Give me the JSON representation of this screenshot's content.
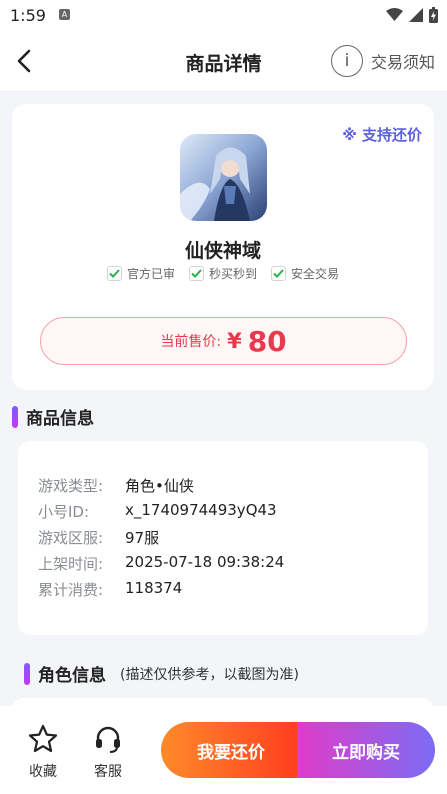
{
  "status": {
    "time": "1:59",
    "app_badge": "A"
  },
  "nav": {
    "title": "商品详情",
    "notice_label": "交易须知"
  },
  "product": {
    "bargain_tag": "※ 支持还价",
    "game_title": "仙侠神域",
    "badges": [
      {
        "label": "官方已审"
      },
      {
        "label": "秒买秒到"
      },
      {
        "label": "安全交易"
      }
    ],
    "price_label": "当前售价:",
    "price_symbol": "¥",
    "price_value": "80"
  },
  "product_info": {
    "title": "商品信息",
    "rows": [
      {
        "key": "游戏类型:",
        "value": "角色•仙侠"
      },
      {
        "key": "小号ID:",
        "value": "x_1740974493yQ43"
      },
      {
        "key": "游戏区服:",
        "value": "97服"
      },
      {
        "key": "上架时间:",
        "value": "2025-07-18 09:38:24"
      },
      {
        "key": "累计消费:",
        "value": "118374"
      }
    ]
  },
  "role_info": {
    "title": "角色信息",
    "note": "(描述仅供参考，以截图为准)"
  },
  "bottom": {
    "favorite_label": "收藏",
    "service_label": "客服",
    "bargain_button": "我要还价",
    "buy_button": "立即购买"
  },
  "colors": {
    "accent": "#5b5fe0",
    "price": "#e8394f",
    "check": "#2bb24c"
  }
}
